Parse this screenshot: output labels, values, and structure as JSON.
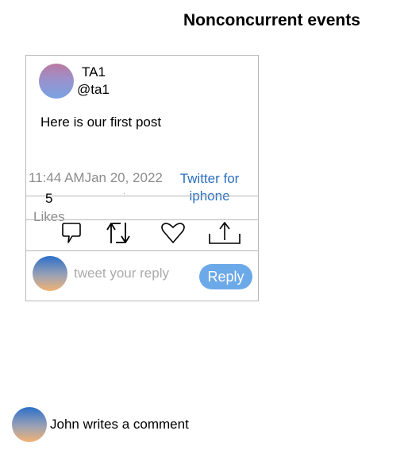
{
  "page": {
    "title": "Nonconcurrent events"
  },
  "tweet": {
    "display_name": "TA1",
    "handle": "@ta1",
    "text": "Here is our first post",
    "time": "11:44 AMJan 20, 2022",
    "separator": "·",
    "source": "Twitter for iphone",
    "likes_count": "5",
    "likes_label": "Likes"
  },
  "actions": [
    {
      "name": "comment",
      "icon": "comment-icon"
    },
    {
      "name": "retweet",
      "icon": "retweet-icon"
    },
    {
      "name": "like",
      "icon": "heart-icon"
    },
    {
      "name": "share",
      "icon": "share-icon"
    }
  ],
  "reply": {
    "placeholder": "tweet your reply",
    "button_label": "Reply",
    "button_color": "#6ca9e8"
  },
  "event": {
    "text": "John writes a comment"
  },
  "colors": {
    "link": "#2a6fbf",
    "muted": "#8c8c8c",
    "border": "#b7b7b7"
  }
}
